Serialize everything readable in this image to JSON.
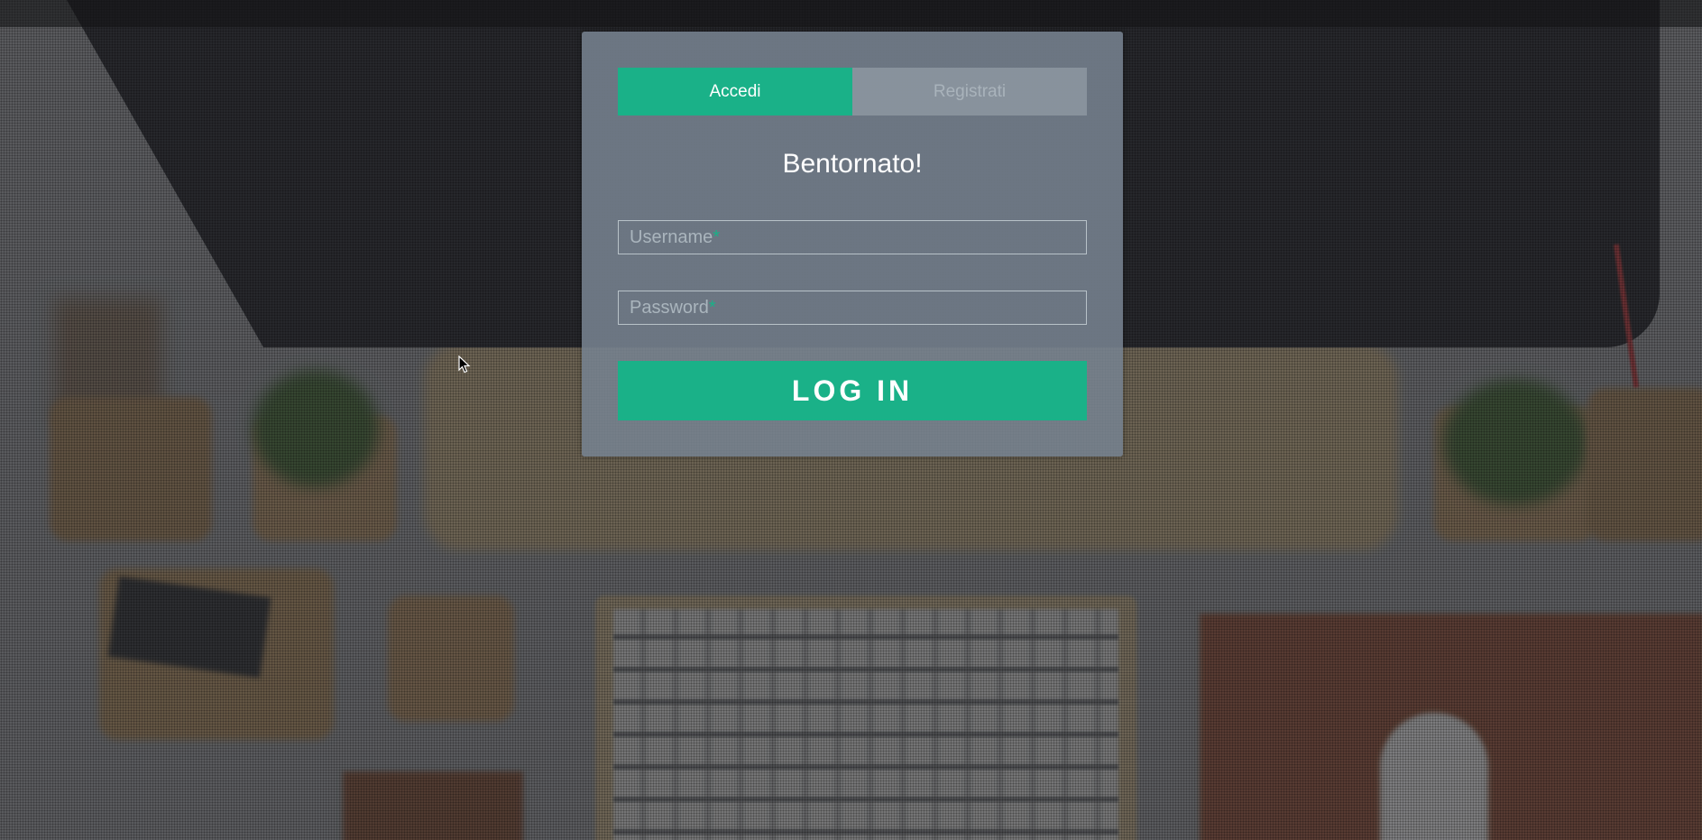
{
  "tabs": {
    "login_label": "Accedi",
    "register_label": "Registrati"
  },
  "form": {
    "title": "Bentornato!",
    "username_label": "Username",
    "password_label": "Password",
    "required_marker": "*",
    "submit_label": "LOG IN"
  },
  "colors": {
    "accent": "#1ab188",
    "card_background": "#76828f",
    "text": "#ffffff"
  },
  "icons": {
    "pointer": "mouse-cursor-icon"
  }
}
